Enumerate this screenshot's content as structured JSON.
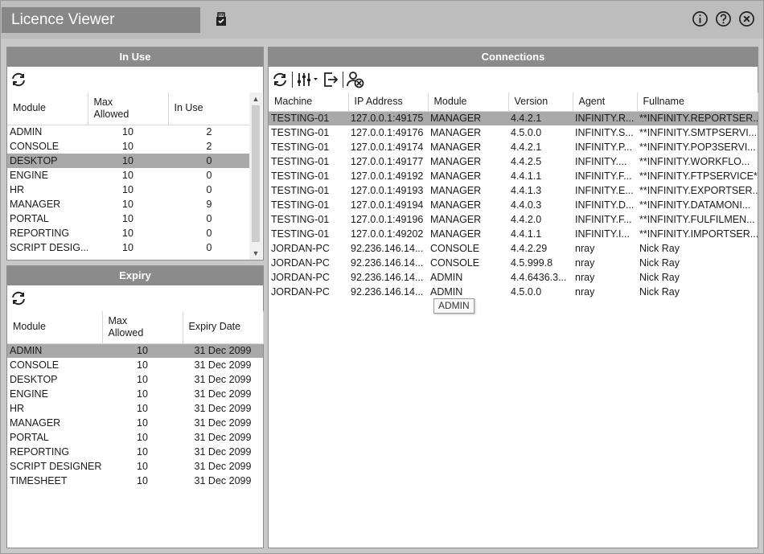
{
  "app": {
    "title": "Licence Viewer"
  },
  "title_icons": [
    "usb-key-icon",
    "info-icon",
    "help-icon",
    "close-icon"
  ],
  "inuse": {
    "header": "In Use",
    "columns": [
      "Module",
      "Max\nAllowed",
      "In Use"
    ],
    "rows": [
      {
        "module": "ADMIN",
        "max": "10",
        "inuse": "2"
      },
      {
        "module": "CONSOLE",
        "max": "10",
        "inuse": "2"
      },
      {
        "module": "DESKTOP",
        "max": "10",
        "inuse": "0"
      },
      {
        "module": "ENGINE",
        "max": "10",
        "inuse": "0"
      },
      {
        "module": "HR",
        "max": "10",
        "inuse": "0"
      },
      {
        "module": "MANAGER",
        "max": "10",
        "inuse": "9"
      },
      {
        "module": "PORTAL",
        "max": "10",
        "inuse": "0"
      },
      {
        "module": "REPORTING",
        "max": "10",
        "inuse": "0"
      },
      {
        "module": "SCRIPT DESIG...",
        "max": "10",
        "inuse": "0"
      }
    ],
    "selected_index": 2
  },
  "expiry": {
    "header": "Expiry",
    "columns": [
      "Module",
      "Max\nAllowed",
      "Expiry Date"
    ],
    "rows": [
      {
        "module": "ADMIN",
        "max": "10",
        "date": "31 Dec 2099"
      },
      {
        "module": "CONSOLE",
        "max": "10",
        "date": "31 Dec 2099"
      },
      {
        "module": "DESKTOP",
        "max": "10",
        "date": "31 Dec 2099"
      },
      {
        "module": "ENGINE",
        "max": "10",
        "date": "31 Dec 2099"
      },
      {
        "module": "HR",
        "max": "10",
        "date": "31 Dec 2099"
      },
      {
        "module": "MANAGER",
        "max": "10",
        "date": "31 Dec 2099"
      },
      {
        "module": "PORTAL",
        "max": "10",
        "date": "31 Dec 2099"
      },
      {
        "module": "REPORTING",
        "max": "10",
        "date": "31 Dec 2099"
      },
      {
        "module": "SCRIPT DESIGNER",
        "max": "10",
        "date": "31 Dec 2099"
      },
      {
        "module": "TIMESHEET",
        "max": "10",
        "date": "31 Dec 2099"
      }
    ],
    "selected_index": 0
  },
  "connections": {
    "header": "Connections",
    "columns": [
      "Machine",
      "IP Address",
      "Module",
      "Version",
      "Agent",
      "Fullname"
    ],
    "rows": [
      {
        "machine": "TESTING-01",
        "ip": "127.0.0.1:49175",
        "module": "MANAGER",
        "version": "4.4.2.1",
        "agent": "INFINITY.R...",
        "fullname": "**INFINITY.REPORTSER..."
      },
      {
        "machine": "TESTING-01",
        "ip": "127.0.0.1:49176",
        "module": "MANAGER",
        "version": "4.5.0.0",
        "agent": "INFINITY.S...",
        "fullname": "**INFINITY.SMTPSERVI..."
      },
      {
        "machine": "TESTING-01",
        "ip": "127.0.0.1:49174",
        "module": "MANAGER",
        "version": "4.4.2.1",
        "agent": "INFINITY.P...",
        "fullname": "**INFINITY.POP3SERVI..."
      },
      {
        "machine": "TESTING-01",
        "ip": "127.0.0.1:49177",
        "module": "MANAGER",
        "version": "4.4.2.5",
        "agent": "INFINITY....",
        "fullname": "**INFINITY.WORKFLO..."
      },
      {
        "machine": "TESTING-01",
        "ip": "127.0.0.1:49192",
        "module": "MANAGER",
        "version": "4.4.1.1",
        "agent": "INFINITY.F...",
        "fullname": "**INFINITY.FTPSERVICE**"
      },
      {
        "machine": "TESTING-01",
        "ip": "127.0.0.1:49193",
        "module": "MANAGER",
        "version": "4.4.1.3",
        "agent": "INFINITY.E...",
        "fullname": "**INFINITY.EXPORTSER..."
      },
      {
        "machine": "TESTING-01",
        "ip": "127.0.0.1:49194",
        "module": "MANAGER",
        "version": "4.4.0.3",
        "agent": "INFINITY.D...",
        "fullname": "**INFINITY.DATAMONI..."
      },
      {
        "machine": "TESTING-01",
        "ip": "127.0.0.1:49196",
        "module": "MANAGER",
        "version": "4.4.2.0",
        "agent": "INFINITY.F...",
        "fullname": "**INFINITY.FULFILMEN..."
      },
      {
        "machine": "TESTING-01",
        "ip": "127.0.0.1:49202",
        "module": "MANAGER",
        "version": "4.4.1.1",
        "agent": "INFINITY.I...",
        "fullname": "**INFINITY.IMPORTSER..."
      },
      {
        "machine": "JORDAN-PC",
        "ip": "92.236.146.14...",
        "module": "CONSOLE",
        "version": "4.4.2.29",
        "agent": "nray",
        "fullname": "Nick Ray"
      },
      {
        "machine": "JORDAN-PC",
        "ip": "92.236.146.14...",
        "module": "CONSOLE",
        "version": "4.5.999.8",
        "agent": "nray",
        "fullname": "Nick Ray"
      },
      {
        "machine": "JORDAN-PC",
        "ip": "92.236.146.14...",
        "module": "ADMIN",
        "version": "4.4.6436.3...",
        "agent": "nray",
        "fullname": "Nick Ray"
      },
      {
        "machine": "JORDAN-PC",
        "ip": "92.236.146.14...",
        "module": "ADMIN",
        "version": "4.5.0.0",
        "agent": "nray",
        "fullname": "Nick Ray"
      }
    ],
    "selected_index": 0,
    "tooltip": "ADMIN",
    "toolbar_icons": [
      "refresh-icon",
      "column-settings-icon",
      "export-icon",
      "disconnect-user-icon"
    ]
  },
  "colors": {
    "header_bg": "#8b8b8b",
    "selected_row": "#a9a9a9",
    "title_bg": "#878787",
    "window_bg": "#c8c8c8"
  }
}
